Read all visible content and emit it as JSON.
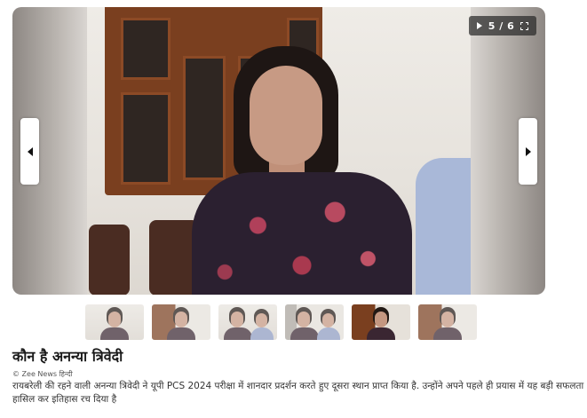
{
  "gallery": {
    "counter": "5 / 6",
    "play_icon": "play-icon",
    "fullscreen_icon": "fullscreen-icon",
    "prev_icon": "chevron-left-icon",
    "next_icon": "chevron-right-icon",
    "thumbnail_count": 6,
    "active_thumbnail": 5
  },
  "article": {
    "title": "कौन है अनन्या त्रिवेदी",
    "credit": "© Zee News हिन्दी",
    "description": "रायबरेली की रहने वाली अनन्या त्रिवेदी ने यूपी PCS 2024 परीक्षा में शानदार प्रदर्शन करते हुए दूसरा स्थान प्राप्त किया है. उन्होंने अपने पहले ही प्रयास में यह बड़ी सफलता हासिल कर इतिहास रच दिया है"
  }
}
